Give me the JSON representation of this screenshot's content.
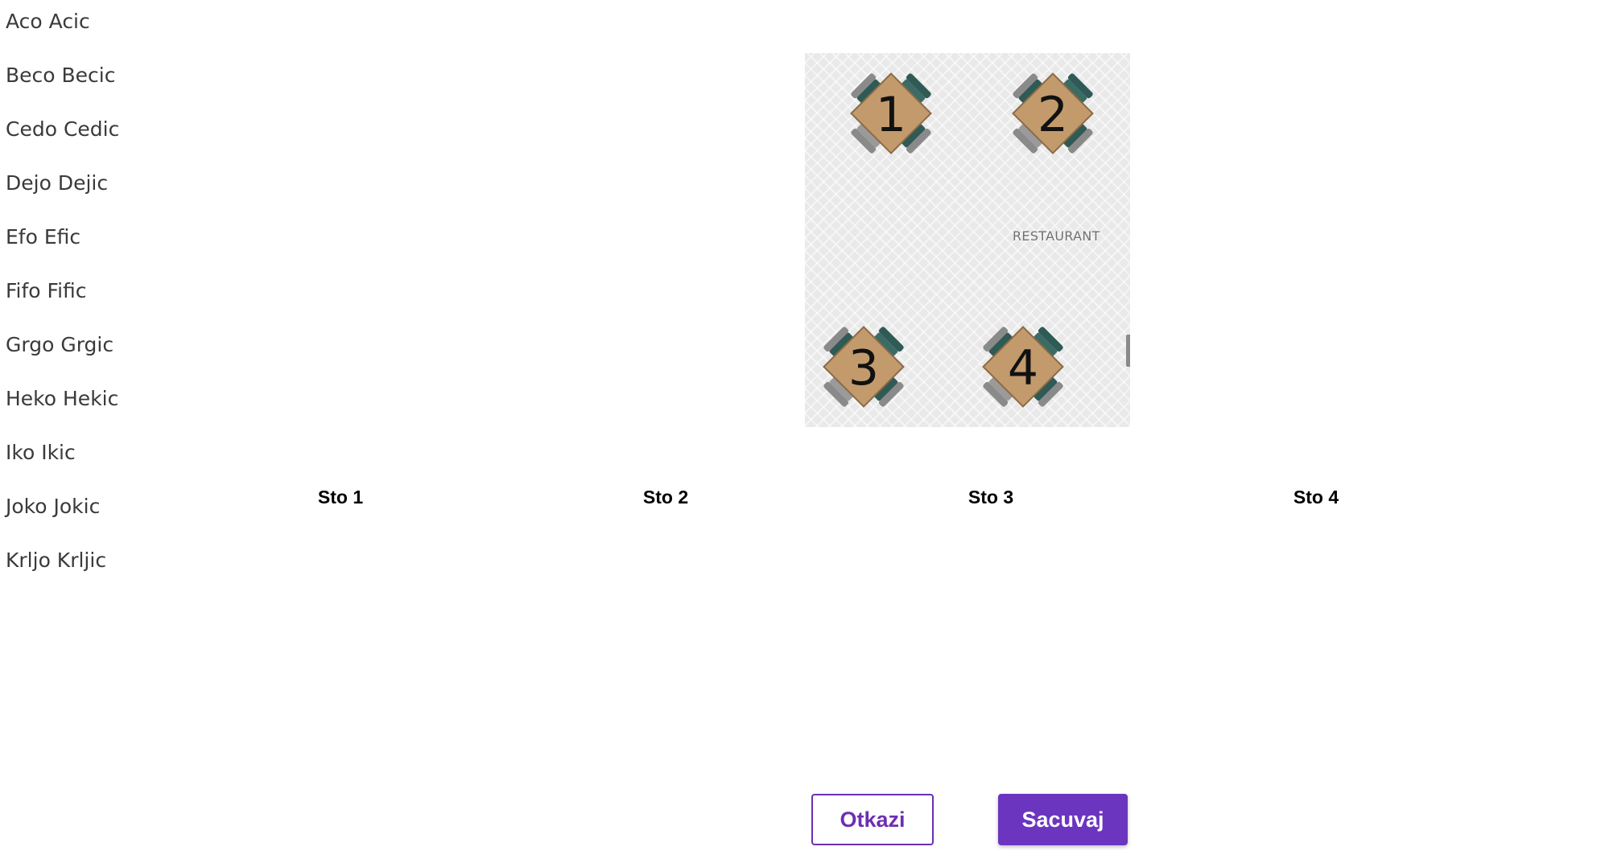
{
  "guests": [
    "Aco Acic",
    "Beco Becic",
    "Cedo Cedic",
    "Dejo Dejic",
    "Efo Efic",
    "Fifo Fific",
    "Grgo Grgic",
    "Heko Hekic",
    "Iko Ikic",
    "Joko Jokic",
    "Krljo Krljic"
  ],
  "floor_plan": {
    "label": "RESTAURANT",
    "tables": [
      {
        "number": "1"
      },
      {
        "number": "2"
      },
      {
        "number": "3"
      },
      {
        "number": "4"
      }
    ]
  },
  "zones": [
    {
      "label": "Sto 1"
    },
    {
      "label": "Sto 2"
    },
    {
      "label": "Sto 3"
    },
    {
      "label": "Sto 4"
    }
  ],
  "actions": {
    "cancel_label": "Otkazi",
    "save_label": "Sacuvaj"
  },
  "colors": {
    "accent": "#6b35bf",
    "table_wood": "#c29a6c",
    "chair_seat": "#2f5a55",
    "chair_back": "#8a8a8a",
    "floor": "#e9e9e9"
  }
}
